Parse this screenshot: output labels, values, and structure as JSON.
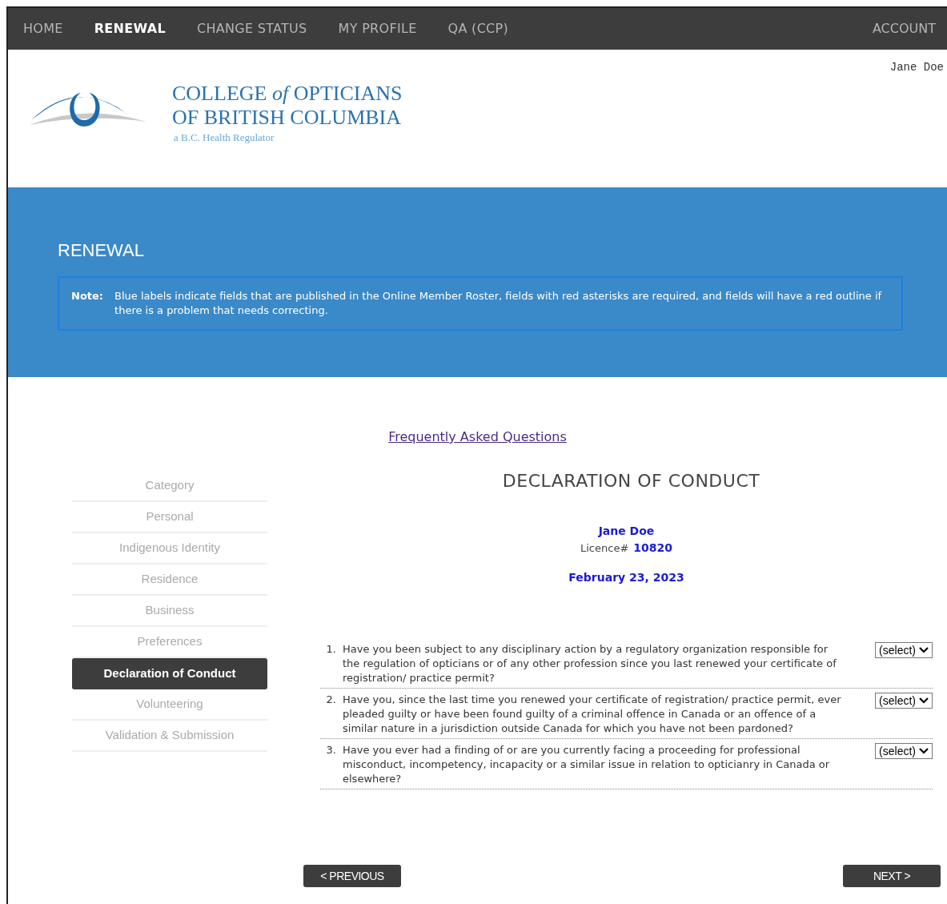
{
  "nav": {
    "items": [
      {
        "label": "HOME",
        "selected": false
      },
      {
        "label": "RENEWAL",
        "selected": true
      },
      {
        "label": "CHANGE STATUS",
        "selected": false
      },
      {
        "label": "MY PROFILE",
        "selected": false
      },
      {
        "label": "QA (CCP)",
        "selected": false
      }
    ],
    "account": "ACCOUNT"
  },
  "header": {
    "user": "Jane Doe",
    "logo_lines": [
      "COLLEGE *of* OPTICIANS",
      "OF BRITISH COLUMBIA"
    ],
    "logo_tagline": "a B.C. Health Regulator"
  },
  "banner": {
    "title": "RENEWAL",
    "note_label": "Note:",
    "note_text": "Blue labels indicate fields that are published in the Online Member Roster, fields with red asterisks are required, and fields will have a red outline if there is a problem that needs correcting."
  },
  "faq_link": "Frequently Asked Questions",
  "steps": [
    {
      "label": "Category",
      "selected": false
    },
    {
      "label": "Personal",
      "selected": false
    },
    {
      "label": "Indigenous Identity",
      "selected": false
    },
    {
      "label": "Residence",
      "selected": false
    },
    {
      "label": "Business",
      "selected": false
    },
    {
      "label": "Preferences",
      "selected": false
    },
    {
      "label": "Declaration of Conduct",
      "selected": true
    },
    {
      "label": "Volunteering",
      "selected": false
    },
    {
      "label": "Validation & Submission",
      "selected": false
    }
  ],
  "form": {
    "title": "DECLARATION OF CONDUCT",
    "member_name": "Jane Doe",
    "licence_label": "Licence#",
    "licence_number": "10820",
    "date": "February 23, 2023",
    "questions": [
      {
        "number": "1.",
        "text": "Have you been subject to any disciplinary action by a regulatory organization responsible for the regulation of opticians or of any other profession since you last renewed your certificate of registration/ practice permit?",
        "answer": "(select)"
      },
      {
        "number": "2.",
        "text": "Have you, since the last time you renewed your certificate of registration/ practice permit, ever pleaded guilty or have been found guilty of a criminal offence in Canada or an offence of a similar nature in a jurisdiction outside Canada for which you have not been pardoned?",
        "answer": "(select)"
      },
      {
        "number": "3.",
        "text": "Have you ever had a finding of or are you currently facing a proceeding for professional misconduct, incompetency, incapacity or a similar issue in relation to opticianry in Canada or elsewhere?",
        "answer": "(select)"
      }
    ]
  },
  "buttons": {
    "previous": "< PREVIOUS",
    "next": "NEXT >"
  }
}
